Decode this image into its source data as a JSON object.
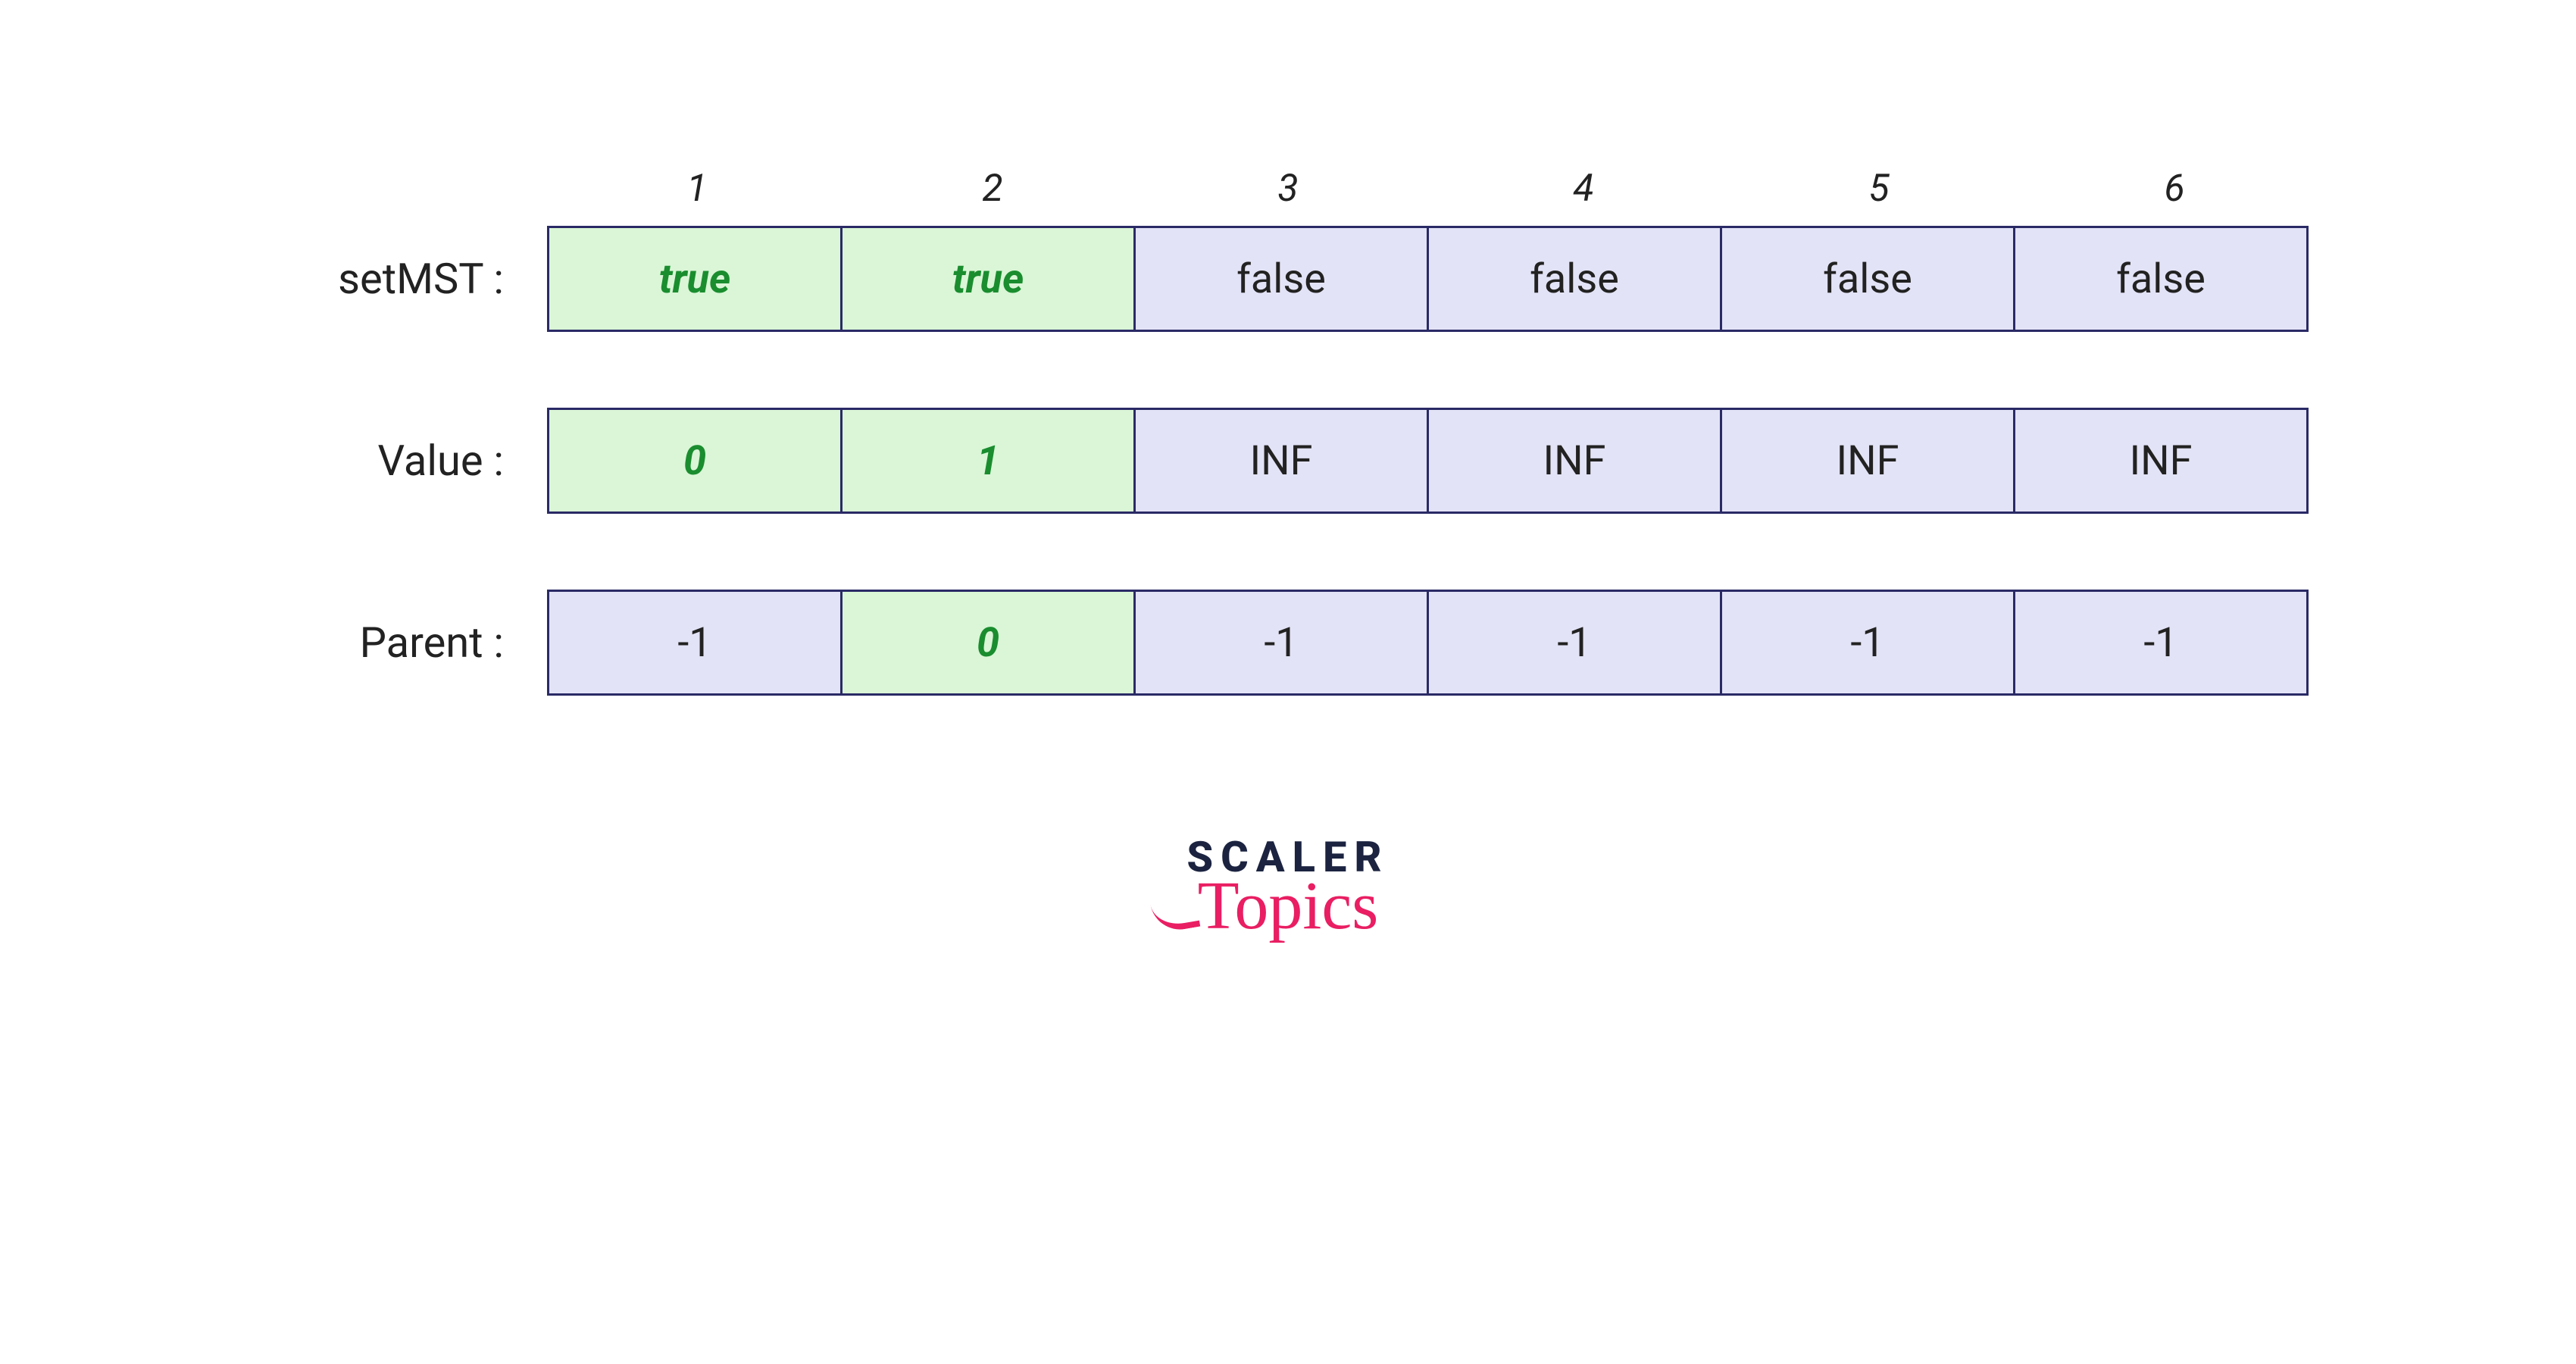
{
  "chart_data": {
    "type": "table",
    "indices": [
      "1",
      "2",
      "3",
      "4",
      "5",
      "6"
    ],
    "rows": [
      {
        "label": "setMST :",
        "cells": [
          {
            "value": "true",
            "highlight": true
          },
          {
            "value": "true",
            "highlight": true
          },
          {
            "value": "false",
            "highlight": false
          },
          {
            "value": "false",
            "highlight": false
          },
          {
            "value": "false",
            "highlight": false
          },
          {
            "value": "false",
            "highlight": false
          }
        ]
      },
      {
        "label": "Value :",
        "cells": [
          {
            "value": "0",
            "highlight": true
          },
          {
            "value": "1",
            "highlight": true
          },
          {
            "value": "INF",
            "highlight": false
          },
          {
            "value": "INF",
            "highlight": false
          },
          {
            "value": "INF",
            "highlight": false
          },
          {
            "value": "INF",
            "highlight": false
          }
        ]
      },
      {
        "label": "Parent :",
        "cells": [
          {
            "value": "-1",
            "highlight": false
          },
          {
            "value": "0",
            "highlight": true
          },
          {
            "value": "-1",
            "highlight": false
          },
          {
            "value": "-1",
            "highlight": false
          },
          {
            "value": "-1",
            "highlight": false
          },
          {
            "value": "-1",
            "highlight": false
          }
        ]
      }
    ]
  },
  "logo": {
    "line1": "SCALER",
    "line2": "Topics"
  },
  "colors": {
    "cellBorder": "#2a2a66",
    "cellBg": "#e3e3f7",
    "highlightBg": "#daf6d6",
    "highlightText": "#1a8d2f",
    "logoDark": "#1b2340",
    "logoPink": "#e91e63"
  }
}
